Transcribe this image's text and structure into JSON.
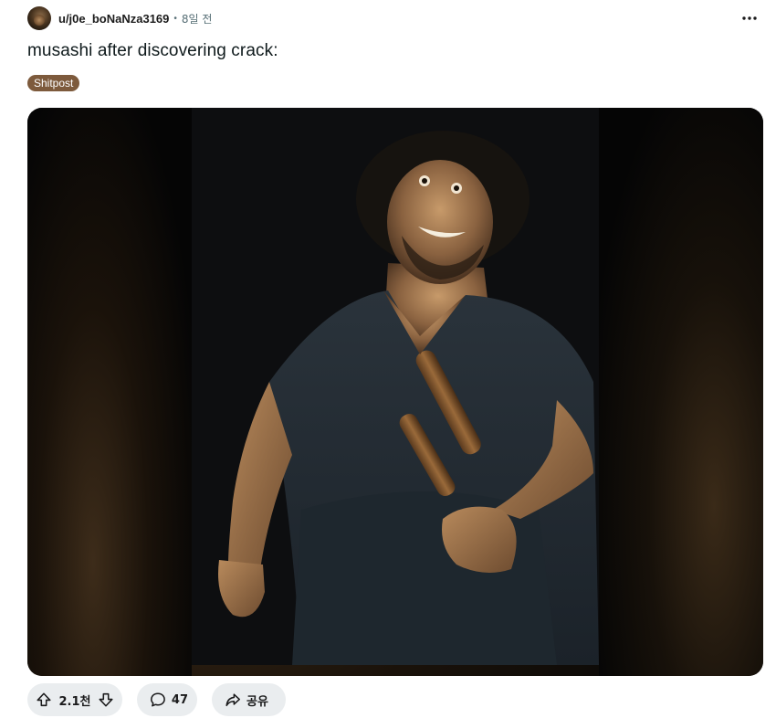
{
  "post": {
    "author": "u/j0e_boNaNza3169",
    "separator": "•",
    "time_ago": "8일 전",
    "title": "musashi after discovering crack:",
    "flair": {
      "label": "Shitpost",
      "color": "#7d5a3c"
    }
  },
  "actions": {
    "score": "2.1천",
    "comments": "47",
    "share_label": "공유"
  },
  "icons": {
    "more": "more-horizontal-icon",
    "upvote": "arrow-up-icon",
    "downvote": "arrow-down-icon",
    "comment": "speech-bubble-icon",
    "share": "share-arrow-icon"
  },
  "colors": {
    "pill_background": "#eaedef",
    "meta_text": "#576f76"
  }
}
